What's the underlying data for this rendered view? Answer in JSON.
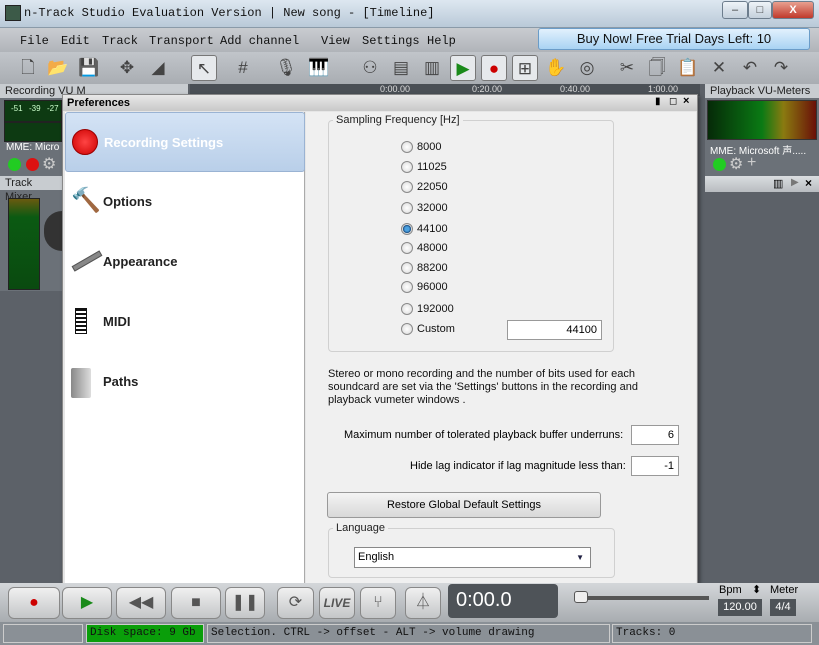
{
  "window": {
    "title": "n-Track Studio Evaluation Version | New song - [Timeline]",
    "minimize": "–",
    "maximize": "□",
    "close": "X"
  },
  "menu": [
    "File",
    "Edit",
    "Track",
    "Transport",
    "Add channel",
    "View",
    "Settings",
    "Help"
  ],
  "buy_button": "Buy Now! Free Trial Days Left: 10",
  "panels": {
    "recording_vu": "Recording VU M",
    "recording_device": "MME: Micro",
    "vu_scale": [
      "-51",
      "-39",
      "-27"
    ],
    "playback_vu": "Playback VU-Meters",
    "playback_device": "MME: Microsoft 声.....",
    "track_mixer": "Track Mixer"
  },
  "timeline_ruler": [
    "0:00.00",
    "0:20.00",
    "0:40.00",
    "1:00.00"
  ],
  "preferences": {
    "title": "Preferences",
    "categories": [
      {
        "label": "Recording Settings",
        "icon": "red-dot-icon"
      },
      {
        "label": "Options",
        "icon": "hammer-icon"
      },
      {
        "label": "Appearance",
        "icon": "ruler-icon"
      },
      {
        "label": "MIDI",
        "icon": "piano-keys-icon"
      },
      {
        "label": "Paths",
        "icon": "folder-icon"
      }
    ],
    "sampling": {
      "legend": "Sampling Frequency [Hz]",
      "options": [
        "8000",
        "11025",
        "22050",
        "32000",
        "44100",
        "48000",
        "88200",
        "96000",
        "192000",
        "Custom"
      ],
      "selected": "44100",
      "custom_value": "44100"
    },
    "info_text": "Stereo or mono recording and the number of bits used for each soundcard are set via the 'Settings' buttons in the recording and playback vumeter windows .",
    "underruns_label": "Maximum number of tolerated playback buffer underruns:",
    "underruns_value": "6",
    "lag_label": "Hide lag indicator if lag magnitude less than:",
    "lag_value": "-1",
    "restore_button": "Restore Global Default Settings",
    "language": {
      "legend": "Language",
      "value": "English"
    }
  },
  "transport": {
    "time": "0:00.0",
    "live": "LIVE",
    "bpm_label": "Bpm",
    "bpm": "120.00",
    "meter_label": "Meter",
    "meter": "4/4"
  },
  "status": {
    "disk": "Disk space: 9 Gb",
    "hint": "Selection. CTRL -> offset - ALT -> volume drawing",
    "tracks": "Tracks: 0"
  }
}
